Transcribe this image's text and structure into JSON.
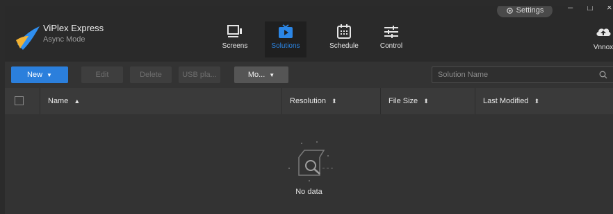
{
  "app": {
    "name": "ViPlex Express",
    "mode": "Async Mode"
  },
  "window": {
    "settings_label": "Settings",
    "minimize": "–",
    "maximize": "□",
    "close": "×"
  },
  "nav": {
    "items": [
      {
        "label": "Screens",
        "icon": "screens-icon",
        "active": false
      },
      {
        "label": "Solutions",
        "icon": "solutions-icon",
        "active": true
      },
      {
        "label": "Schedule",
        "icon": "schedule-icon",
        "active": false
      },
      {
        "label": "Control",
        "icon": "control-icon",
        "active": false
      }
    ],
    "cloud": {
      "label": "Vnnox",
      "icon": "cloud-upload-icon"
    }
  },
  "toolbar": {
    "new_label": "New",
    "edit_label": "Edit",
    "delete_label": "Delete",
    "usb_label": "USB pla...",
    "more_label": "Mo...",
    "search_placeholder": "Solution Name"
  },
  "table": {
    "columns": [
      {
        "label": "Name",
        "sort": "▲"
      },
      {
        "label": "Resolution",
        "sort": "⬍"
      },
      {
        "label": "File Size",
        "sort": "⬍"
      },
      {
        "label": "Last Modified",
        "sort": "⬍"
      }
    ],
    "empty_text": "No data"
  },
  "colors": {
    "accent": "#2b86e6",
    "primary_button": "#2b7fdc",
    "background": "#333333",
    "titlebar": "#2a2a2a"
  }
}
